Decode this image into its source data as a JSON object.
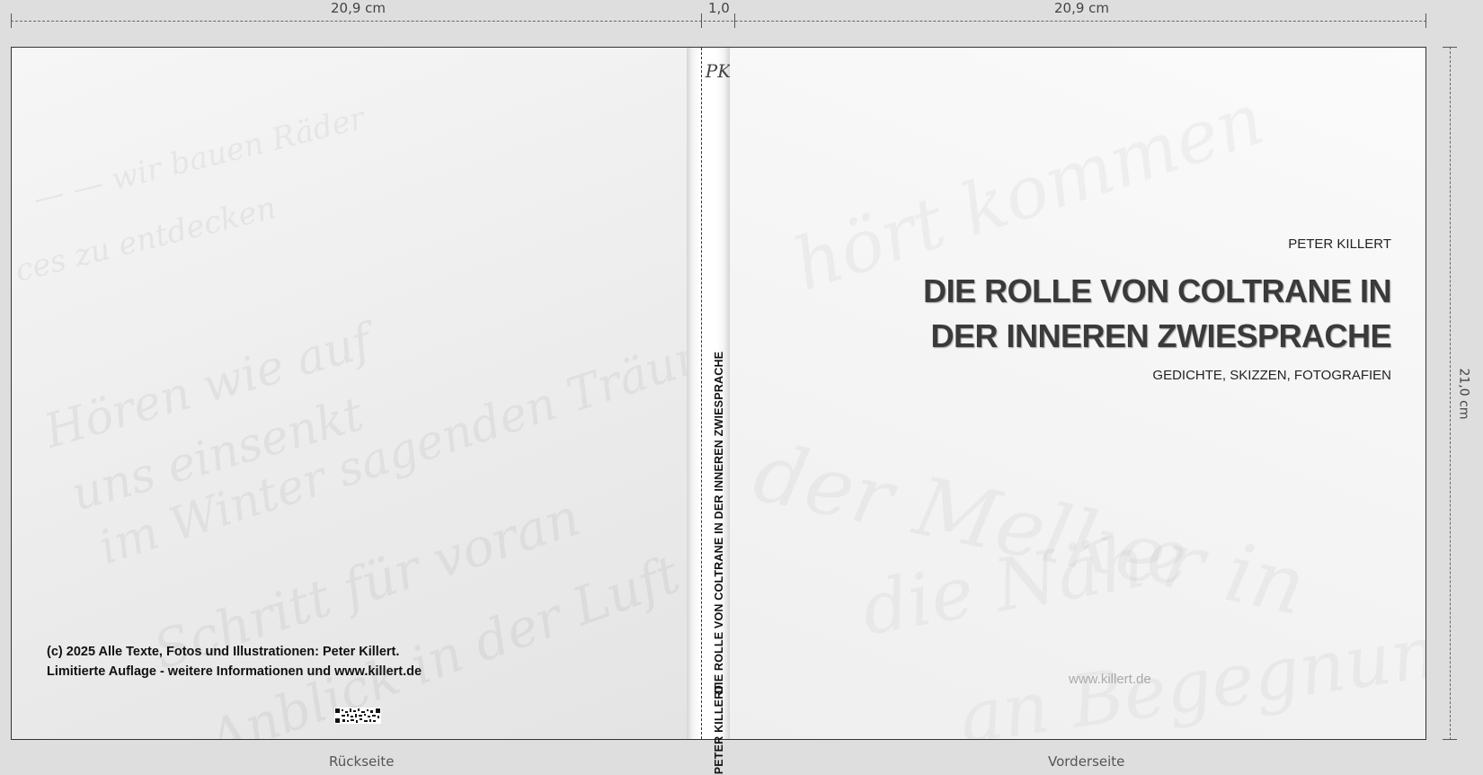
{
  "dimensions": {
    "back_width": "20,9 cm",
    "spine_width": "1,0",
    "front_width": "20,9 cm",
    "height": "21,0 cm"
  },
  "labels": {
    "back": "Rückseite",
    "front": "Vorderseite"
  },
  "spine": {
    "logo": "PK",
    "author": "PETER KILLERT",
    "title": "DIE ROLLE VON COLTRANE IN DER INNEREN ZWIESPRACHE"
  },
  "front_cover": {
    "author": "PETER KILLERT",
    "title_line1": "DIE ROLLE VON COLTRANE IN",
    "title_line2": "DER INNEREN ZWIESPRACHE",
    "subtitle": "GEDICHTE, SKIZZEN, FOTOGRAFIEN",
    "website": "www.killert.de"
  },
  "back_cover": {
    "copyright": "(c) 2025 Alle Texte, Fotos und Illustrationen: Peter Killert.",
    "edition_note": "Limitierte Auflage - weitere Informationen und www.killert.de",
    "background_handwriting": [
      "Hören wie auf",
      "uns einsenkt",
      "im Winter sagenden Träume",
      "Schritt für voran",
      "Anblick in der Luft",
      "wir bauen Räder",
      "zu entdecken"
    ],
    "qr_code": "qr-code-icon"
  },
  "front_background_handwriting": [
    "hört kommen",
    "der Melker in",
    "die Nähe",
    "an Begegnung"
  ]
}
